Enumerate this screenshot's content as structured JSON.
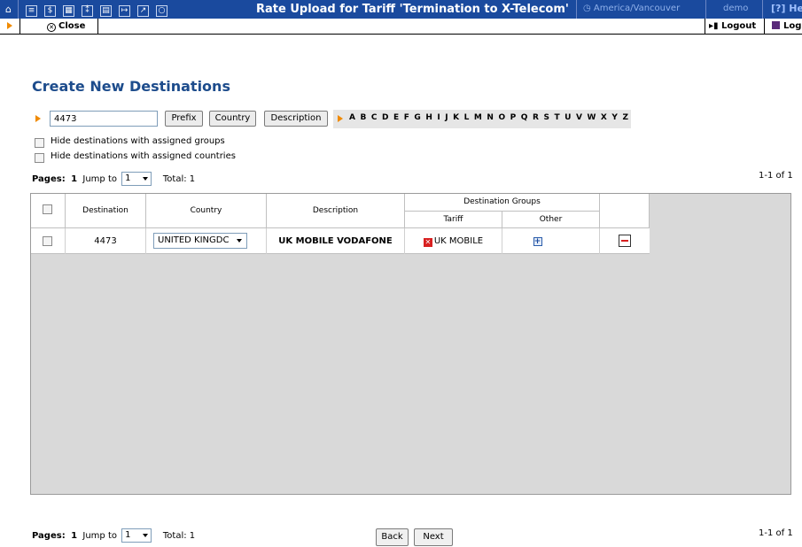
{
  "topbar": {
    "title": "Rate Upload for Tariff 'Termination to X-Telecom'",
    "timezone": "America/Vancouver",
    "user": "demo",
    "help": "Hel",
    "icons": [
      "home-icon",
      "list-icon",
      "dollar-icon",
      "grid-icon",
      "person-icon",
      "tariff-icon",
      "import-icon",
      "chart-icon",
      "search-icon"
    ]
  },
  "secbar": {
    "close": "Close",
    "logout": "Logout",
    "log": "Log"
  },
  "page": {
    "heading": "Create New Destinations"
  },
  "search": {
    "value": "4473",
    "prefix_btn": "Prefix",
    "country_btn": "Country",
    "description_btn": "Description",
    "letters": "A B C D E F G H I J K L M N O P Q R S T U V W X Y Z"
  },
  "filters": {
    "hide_groups": "Hide destinations with assigned groups",
    "hide_countries": "Hide destinations with assigned countries"
  },
  "pagination": {
    "pages_label": "Pages:",
    "current_page": "1",
    "jump_label": "Jump to",
    "jump_value": "1",
    "total": "Total: 1",
    "range": "1-1 of 1"
  },
  "table": {
    "headers": {
      "destination": "Destination",
      "country": "Country",
      "description": "Description",
      "groups": "Destination Groups",
      "tariff": "Tariff",
      "other": "Other"
    },
    "rows": [
      {
        "destination": "4473",
        "country": "UNITED KINGDC",
        "description": "UK MOBILE VODAFONE",
        "tariff_group": "UK MOBILE"
      }
    ]
  },
  "nav": {
    "back": "Back",
    "next": "Next"
  },
  "colors": {
    "topbar": "#1a4a9e",
    "heading": "#1d4c8c",
    "arrow": "#f08a00",
    "remove": "#d82020"
  }
}
